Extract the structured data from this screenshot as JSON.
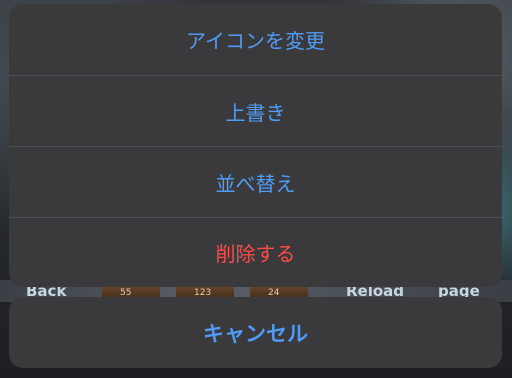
{
  "background": {
    "back_label": "Back",
    "reload_label": "Reload",
    "page_label": "page",
    "thumbnails": [
      "55",
      "123",
      "24"
    ]
  },
  "action_sheet": {
    "actions": [
      {
        "label": "アイコンを変更",
        "style": "default"
      },
      {
        "label": "上書き",
        "style": "default"
      },
      {
        "label": "並べ替え",
        "style": "default"
      },
      {
        "label": "削除する",
        "style": "destructive"
      }
    ],
    "cancel_label": "キャンセル"
  },
  "colors": {
    "action_blue": "#4f9bf5",
    "destructive_red": "#ff4a45",
    "sheet_bg": "#3a3a3c"
  }
}
